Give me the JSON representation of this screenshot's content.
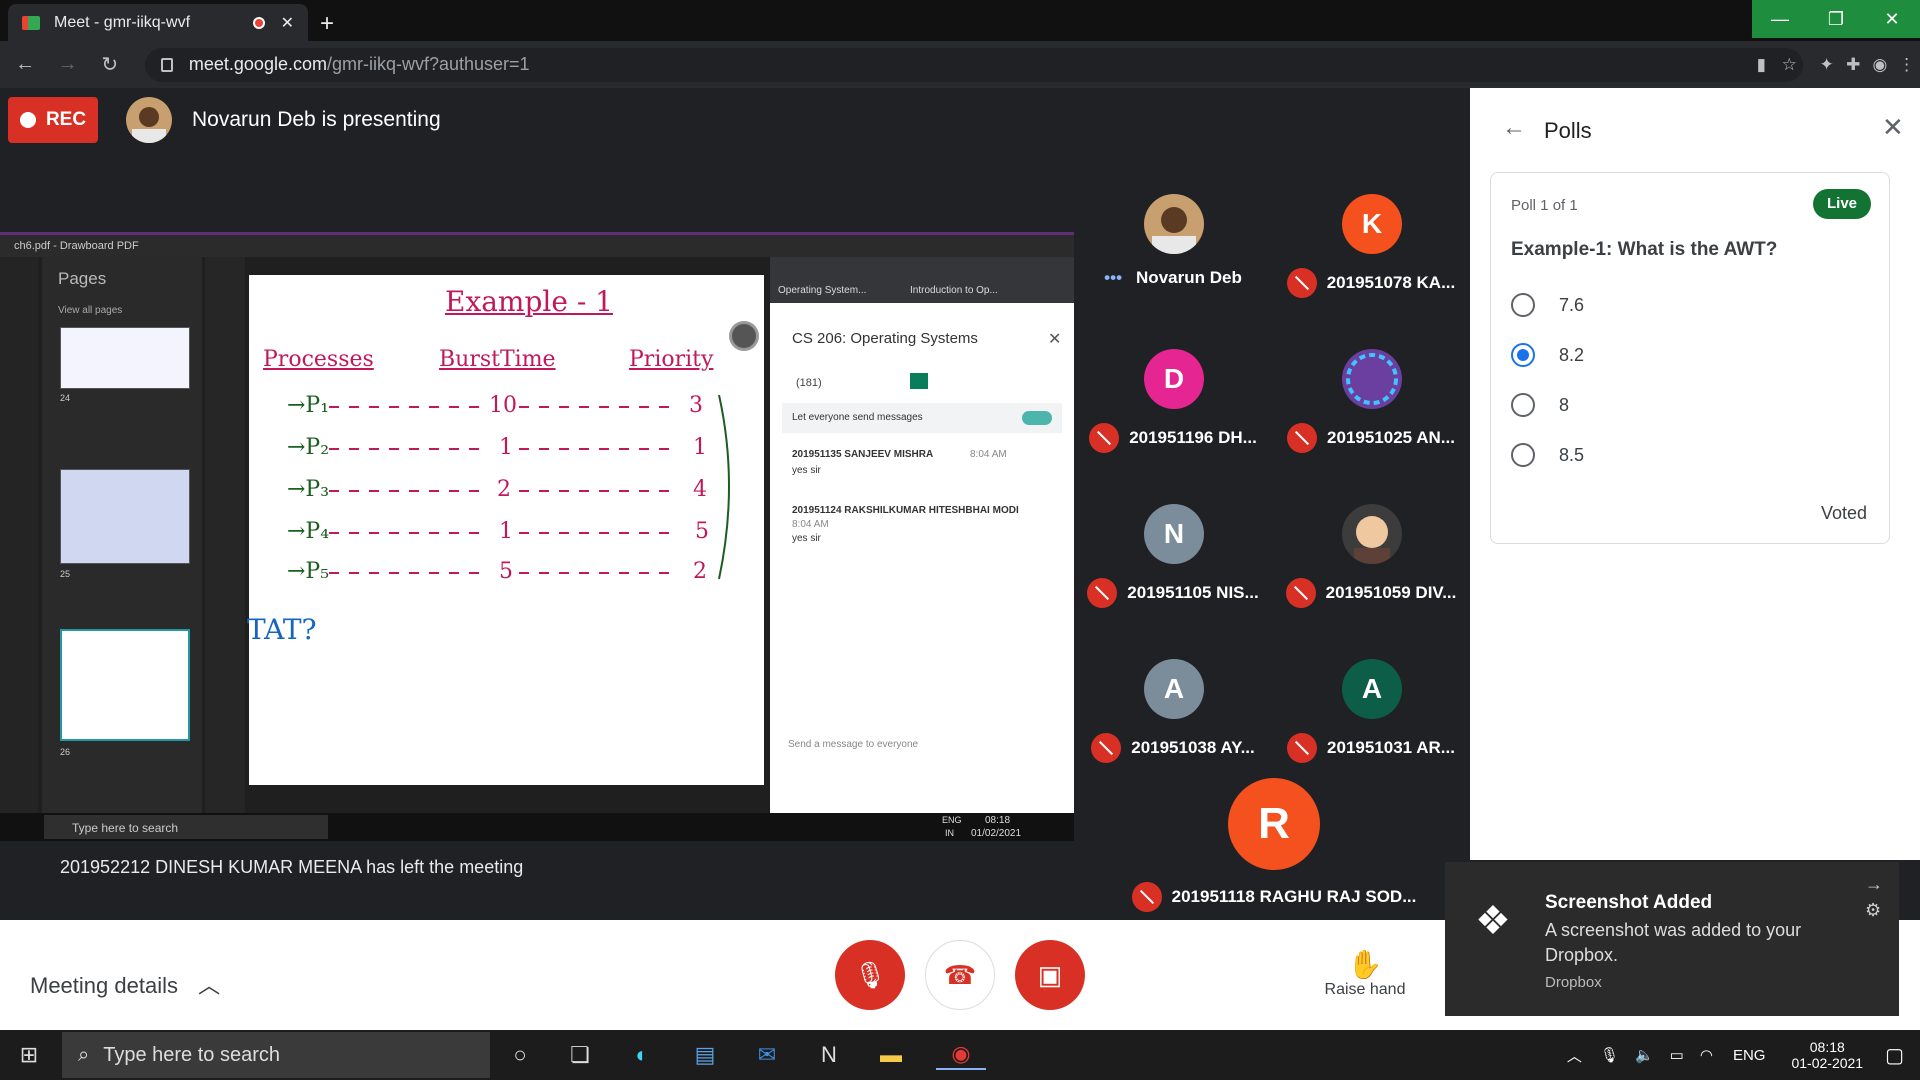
{
  "browser": {
    "tab_title": "Meet - gmr-iikq-wvf",
    "url_host": "meet.google.com",
    "url_path": "/gmr-iikq-wvf?authuser=1"
  },
  "meet": {
    "rec_label": "REC",
    "presenting_text": "Novarun Deb is presenting",
    "participants": [
      {
        "initial": "",
        "name": "Novarun Deb",
        "color": "#c8a070",
        "muted": false
      },
      {
        "initial": "K",
        "name": "201951078 KA...",
        "color": "#f4511e",
        "muted": true
      },
      {
        "initial": "D",
        "name": "201951196 DH...",
        "color": "#e52592",
        "muted": true
      },
      {
        "initial": "",
        "name": "201951025 AN...",
        "color": "#6a3fa0",
        "muted": true
      },
      {
        "initial": "N",
        "name": "201951105 NIS...",
        "color": "#7b8c9a",
        "muted": true
      },
      {
        "initial": "",
        "name": "201951059 DIV...",
        "color": "#3c3c3c",
        "muted": true
      },
      {
        "initial": "A",
        "name": "201951038 AY...",
        "color": "#7b8c9a",
        "muted": true
      },
      {
        "initial": "A",
        "name": "201951031 AR...",
        "color": "#0d5e48",
        "muted": true
      },
      {
        "initial": "R",
        "name": "201951118 RAGHU RAJ SOD...",
        "color": "#f4511e",
        "muted": true
      }
    ],
    "left_meeting_toast": "201952212 DINESH KUMAR MEENA has left the meeting",
    "meeting_details_label": "Meeting details",
    "raise_hand_label": "Raise hand"
  },
  "shared_screen": {
    "pdf_window_title": "ch6.pdf - Drawboard PDF",
    "pages_label": "Pages",
    "view_all_pages": "View all pages",
    "page_numbers": [
      "24",
      "25",
      "26"
    ],
    "slide_heading": "Example - 1",
    "col_headers": [
      "Processes",
      "BurstTime",
      "Priority"
    ],
    "rows": [
      {
        "p": "→P₁",
        "burst": "10",
        "prio": "3"
      },
      {
        "p": "→P₂",
        "burst": "1",
        "prio": "1"
      },
      {
        "p": "→P₃",
        "burst": "2",
        "prio": "4"
      },
      {
        "p": "→P₄",
        "burst": "1",
        "prio": "5"
      },
      {
        "p": "→P₅",
        "burst": "5",
        "prio": "2"
      }
    ],
    "tat_label": "TAT?",
    "browser_tabs": [
      "Operating System...",
      "Introduction to Op..."
    ],
    "chat_title": "CS 206: Operating Systems",
    "people_count": "(181)",
    "let_everyone_send": "Let everyone send messages",
    "messages": [
      {
        "sender": "201951135 SANJEEV MISHRA",
        "time": "8:04 AM",
        "text": "yes sir"
      },
      {
        "sender": "201951124 RAKSHILKUMAR HITESHBHAI MODI",
        "time": "8:04 AM",
        "text": "yes sir"
      }
    ],
    "send_placeholder": "Send a message to everyone",
    "inner_search": "Type here to search",
    "inner_lang": "ENG",
    "inner_region": "IN",
    "inner_time": "08:18",
    "inner_date": "01/02/2021"
  },
  "polls": {
    "title": "Polls",
    "poll_count": "Poll 1 of 1",
    "live_label": "Live",
    "question": "Example-1: What is the AWT?",
    "options": [
      "7.6",
      "8.2",
      "8",
      "8.5"
    ],
    "selected_index": 1,
    "voted_label": "Voted"
  },
  "notification": {
    "title": "Screenshot Added",
    "body": "A screenshot was added to your Dropbox.",
    "source": "Dropbox"
  },
  "taskbar": {
    "search_placeholder": "Type here to search",
    "lang": "ENG",
    "time": "08:18",
    "date": "01-02-2021"
  }
}
